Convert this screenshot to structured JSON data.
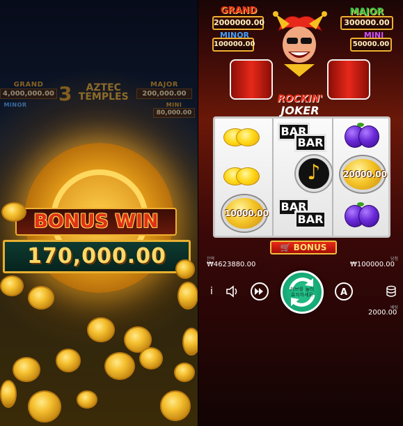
{
  "left_game": {
    "jackpots": {
      "grand_label": "GRAND",
      "grand_value": "4,000,000.00",
      "major_label": "MAJOR",
      "major_value": "200,000.00",
      "minor_label": "MINOR",
      "mini_label": "MINI",
      "mini_value": "80,000.00"
    },
    "logo": {
      "number": "3",
      "line1": "AZTEC",
      "line2": "TEMPLES"
    },
    "bonus_title": "BONUS WIN",
    "bonus_amount": "170,000.00"
  },
  "right_game": {
    "jackpots": {
      "grand_label": "GRAND",
      "grand_value": "2000000.00",
      "major_label": "MAJOR",
      "major_value": "300000.00",
      "minor_label": "MINOR",
      "minor_value": "100000.00",
      "mini_label": "MINI",
      "mini_value": "50000.00"
    },
    "logo": {
      "line1": "ROCKIN'",
      "line2": "JOKER"
    },
    "reels": {
      "bar_label": "BAR",
      "coin_top": "20000.00",
      "coin_bottom": "10000.00",
      "note_icon": "music-note-icon"
    },
    "bonus_button": "BONUS",
    "balance_label": "잔액",
    "balance": "₩4623880.00",
    "win_label": "당첨",
    "win": "₩100000.00",
    "spin_text": "커브를 눌러 유지하세요",
    "bet_label": "베팅",
    "bet": "2000.00",
    "info_label": "i"
  },
  "colors": {
    "gold": "#f0b030",
    "red": "#e8281a",
    "spin_green": "#0a9a68",
    "minor_blue": "#40a0ff",
    "major_green": "#30c048",
    "mini_purple": "#d050ff"
  }
}
